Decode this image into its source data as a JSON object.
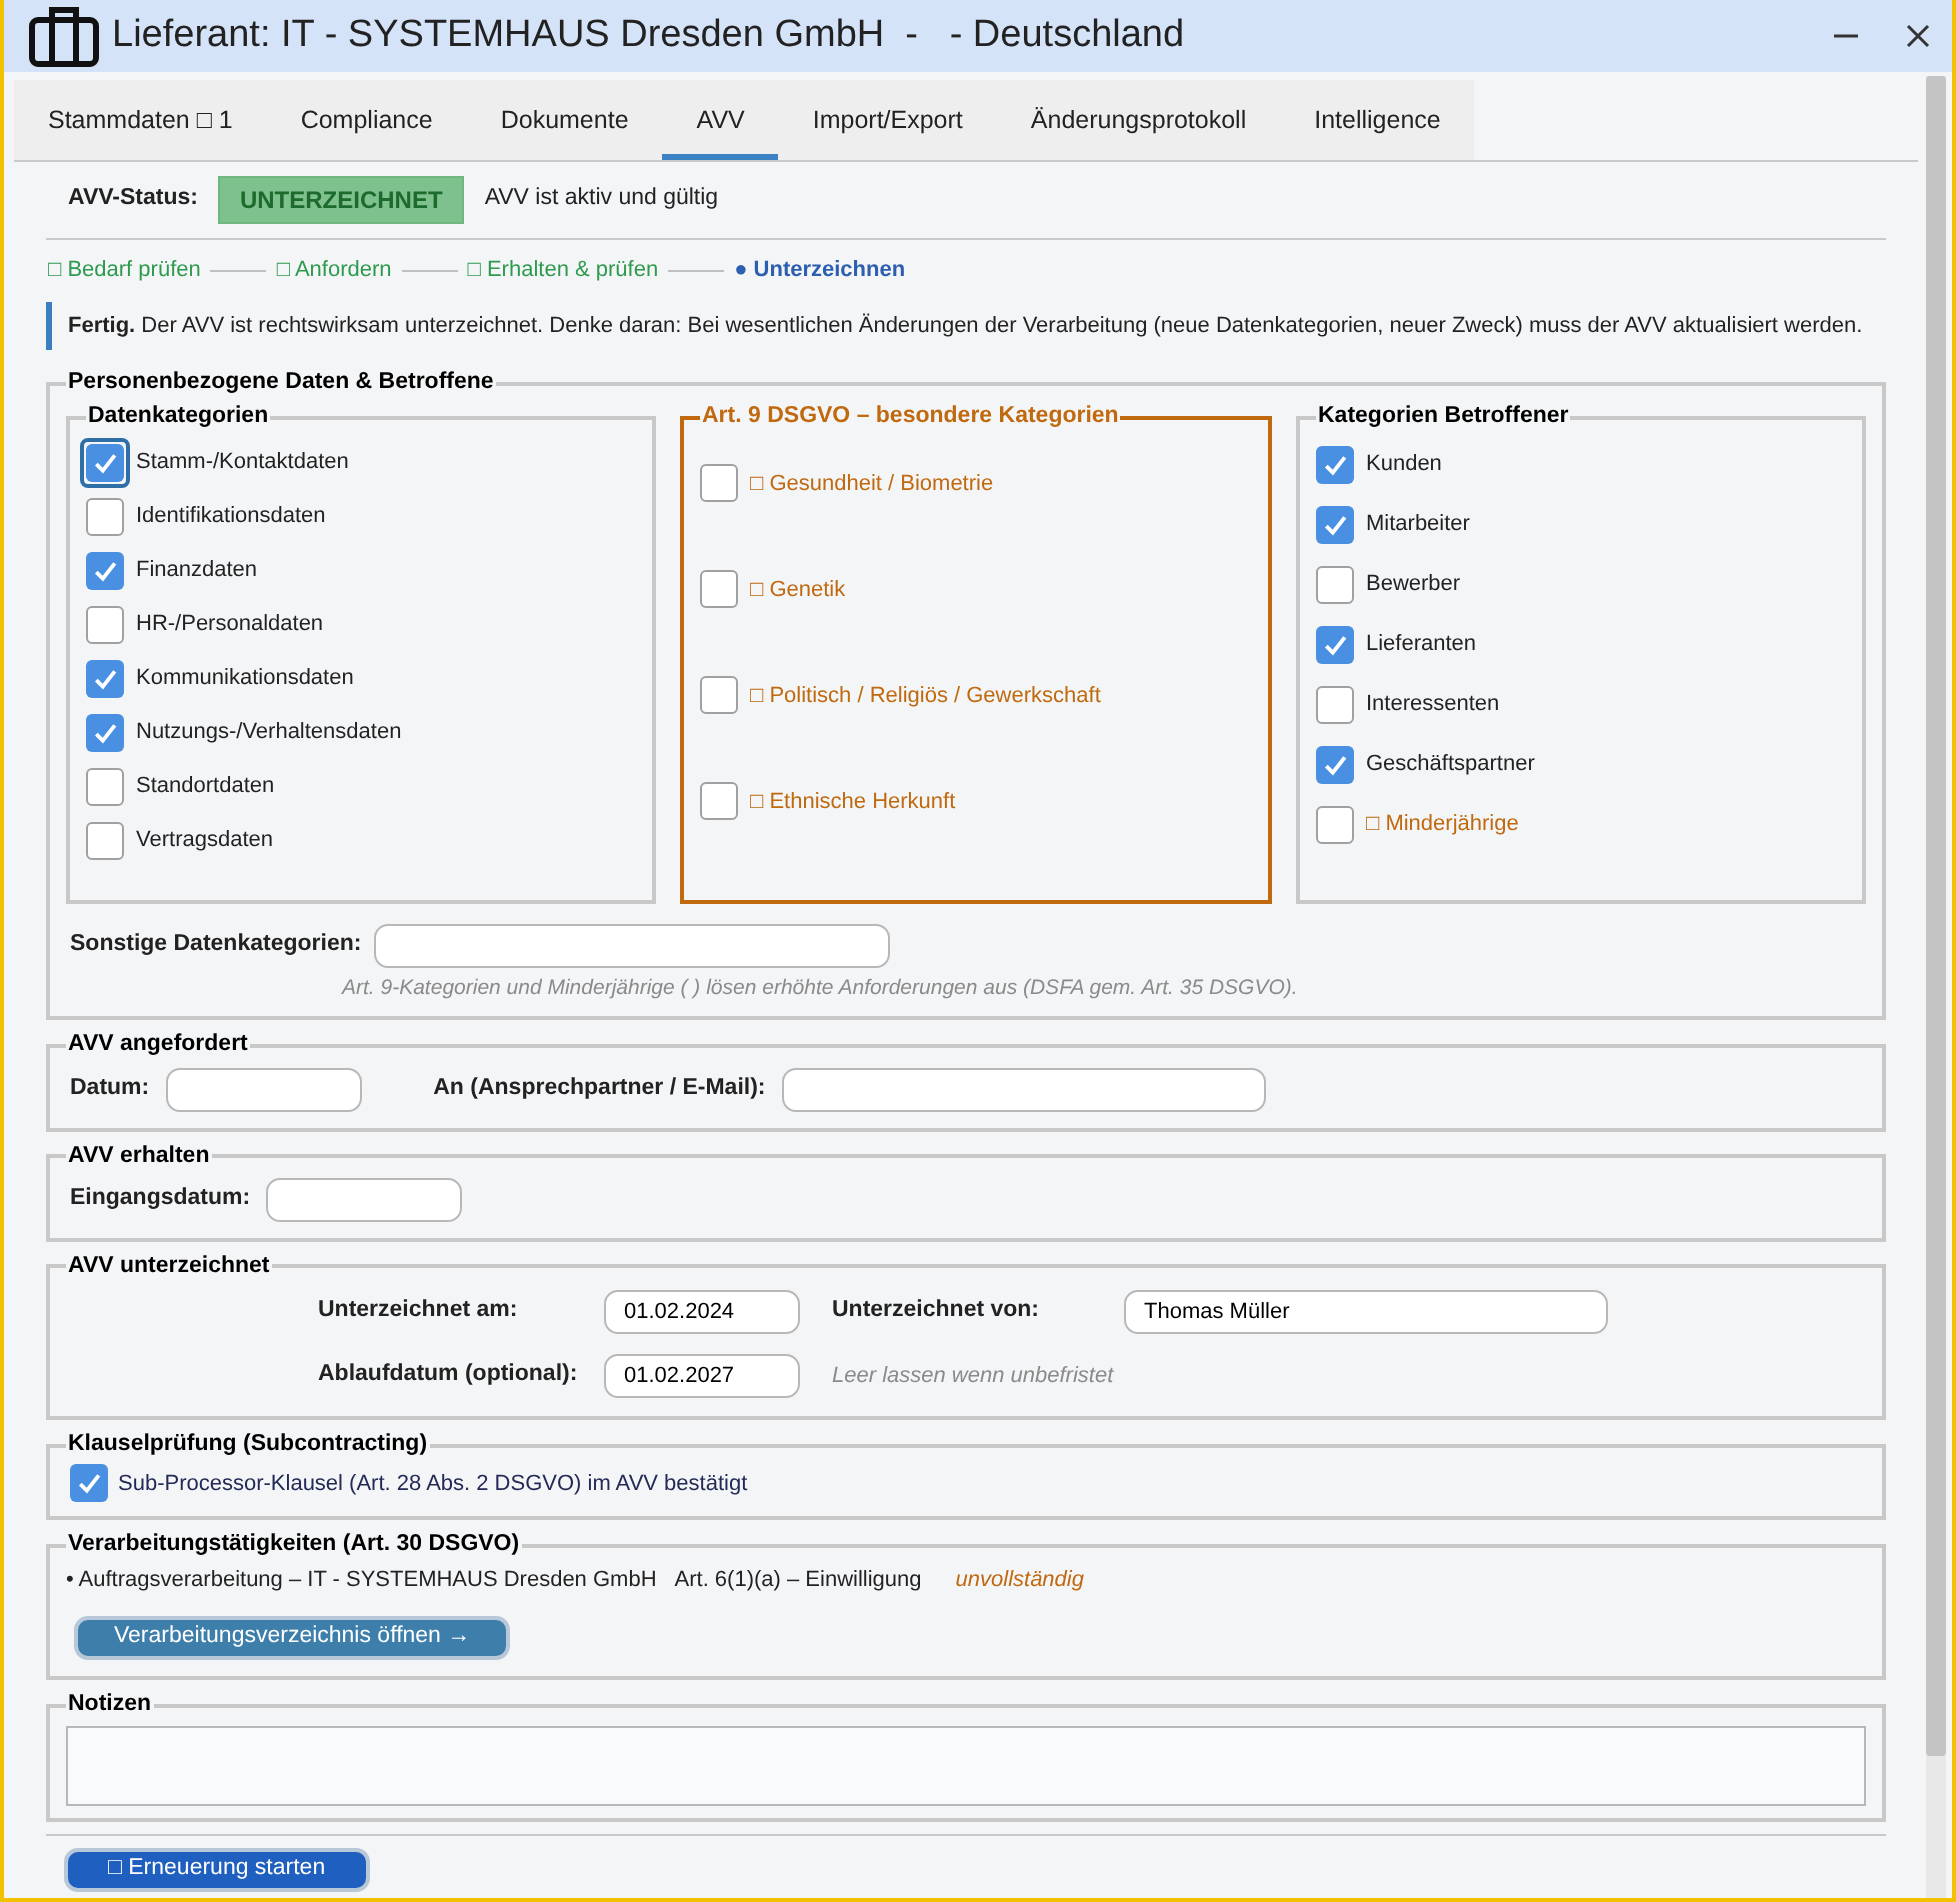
{
  "window": {
    "title": "Lieferant: IT - SYSTEMHAUS Dresden GmbH  -   - Deutschland"
  },
  "tabs": [
    {
      "label": "Stammdaten □ 1",
      "selected": false
    },
    {
      "label": "Compliance",
      "selected": false
    },
    {
      "label": "Dokumente",
      "selected": false
    },
    {
      "label": "AVV",
      "selected": true
    },
    {
      "label": "Import/Export",
      "selected": false
    },
    {
      "label": "Änderungsprotokoll",
      "selected": false
    },
    {
      "label": "Intelligence",
      "selected": false
    }
  ],
  "status": {
    "label": "AVV-Status:",
    "badge": "UNTERZEICHNET",
    "text": "AVV ist aktiv und gültig"
  },
  "steps": [
    {
      "label": "□ Bedarf prüfen",
      "selected": false
    },
    {
      "label": "□ Anfordern",
      "selected": false
    },
    {
      "label": "□ Erhalten & prüfen",
      "selected": false
    },
    {
      "label": "● Unterzeichnen",
      "selected": true
    }
  ],
  "info": {
    "text": "**Fertig.**  Der AVV ist rechtswirksam unterzeichnet. Denke daran: Bei wesentlichen Änderungen der Verarbeitung (neue Datenkategorien, neuer Zweck) muss der AVV aktualisiert werden."
  },
  "personal_data": {
    "title": "Personenbezogene Daten & Betroffene",
    "data_categories": {
      "title": "Datenkategorien",
      "items": [
        {
          "label": "Stamm-/Kontaktdaten",
          "checked": true,
          "focused": true
        },
        {
          "label": "Identifikationsdaten",
          "checked": false,
          "focused": false
        },
        {
          "label": "Finanzdaten",
          "checked": true,
          "focused": false
        },
        {
          "label": "HR-/Personaldaten",
          "checked": false,
          "focused": false
        },
        {
          "label": "Kommunikationsdaten",
          "checked": true,
          "focused": false
        },
        {
          "label": "Nutzungs-/Verhaltensdaten",
          "checked": true,
          "focused": false
        },
        {
          "label": "Standortdaten",
          "checked": false,
          "focused": false
        },
        {
          "label": "Vertragsdaten",
          "checked": false,
          "focused": false
        }
      ]
    },
    "art9": {
      "title": "Art. 9 DSGVO – besondere Kategorien",
      "items": [
        {
          "label": "□ Gesundheit / Biometrie",
          "checked": false
        },
        {
          "label": "□ Genetik",
          "checked": false
        },
        {
          "label": "□ Politisch / Religiös / Gewerkschaft",
          "checked": false
        },
        {
          "label": "□ Ethnische Herkunft",
          "checked": false
        }
      ]
    },
    "subjects": {
      "title": "Kategorien Betroffener",
      "items": [
        {
          "label": "Kunden",
          "checked": true,
          "kind": "normal"
        },
        {
          "label": "Mitarbeiter",
          "checked": true,
          "kind": "normal"
        },
        {
          "label": "Bewerber",
          "checked": false,
          "kind": "normal"
        },
        {
          "label": "Lieferanten",
          "checked": true,
          "kind": "normal"
        },
        {
          "label": "Interessenten",
          "checked": false,
          "kind": "normal"
        },
        {
          "label": "Geschäftspartner",
          "checked": true,
          "kind": "normal"
        },
        {
          "label": "□ Minderjährige",
          "checked": false,
          "kind": "special"
        }
      ]
    },
    "other": {
      "label": "Sonstige Datenkategorien:"
    },
    "hint": "Art. 9-Kategorien und Minderjährige (   ) lösen erhöhte Anforderungen aus (DSFA gem. Art. 35 DSGVO)."
  },
  "requested": {
    "title": "AVV angefordert",
    "fields": [
      {
        "label": "Datum:"
      },
      {
        "label": "An (Ansprechpartner / E-Mail):"
      }
    ]
  },
  "received": {
    "title": "AVV erhalten",
    "fields": [
      {
        "label": "Eingangsdatum:"
      }
    ]
  },
  "signed": {
    "title": "AVV unterzeichnet",
    "signed_on": {
      "label": "Unterzeichnet am:",
      "value": "01.02.2024"
    },
    "signed_by": {
      "label": "Unterzeichnet von:",
      "value": "Thomas Müller"
    },
    "expiry": {
      "label": "Ablaufdatum (optional):",
      "value": "01.02.2027",
      "note": "Leer lassen wenn unbefristet"
    }
  },
  "clauses": {
    "title": "Klauselprüfung (Subcontracting)",
    "items": [
      {
        "label": "Sub-Processor-Klausel (Art. 28 Abs. 2 DSGVO) im AVV bestätigt",
        "checked": true
      }
    ]
  },
  "processing": {
    "title": "Verarbeitungstätigkeiten (Art. 30 DSGVO)",
    "entries": [
      {
        "text": "• Auftragsverarbeitung – IT - SYSTEMHAUS Dresden GmbH",
        "legal": "Art. 6(1)(a) – Einwilligung",
        "status": "unvollständig"
      }
    ],
    "button": "Verarbeitungsverzeichnis öffnen →"
  },
  "notes": {
    "title": "Notizen"
  },
  "footer_button": "□ Erneuerung starten"
}
